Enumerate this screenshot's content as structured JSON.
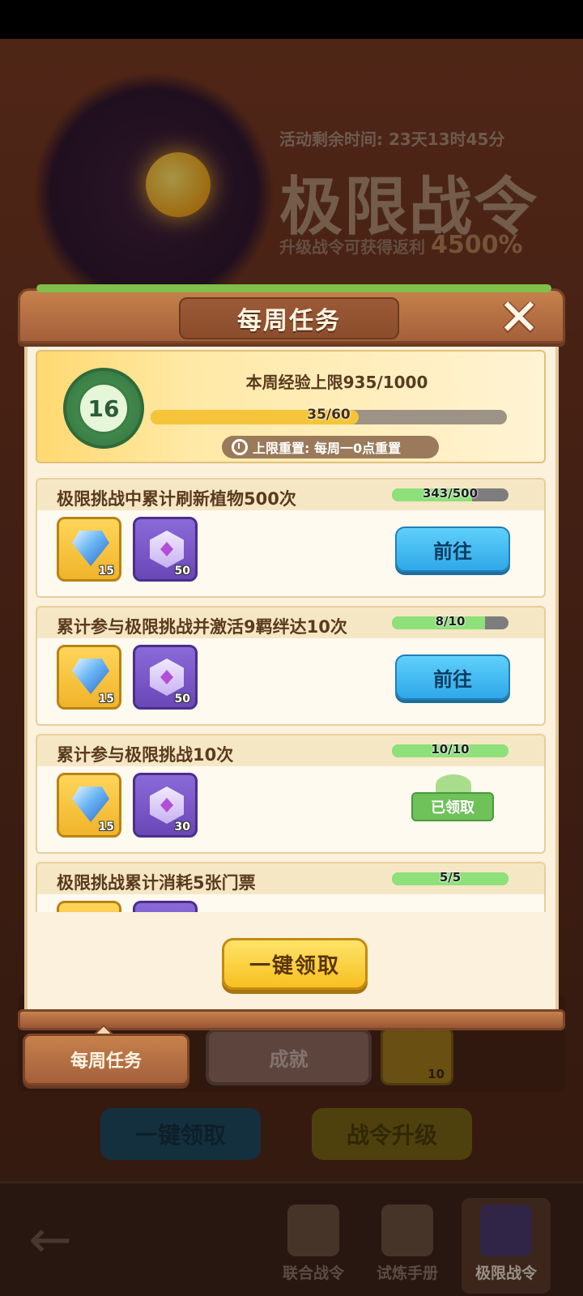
{
  "background": {
    "activity_timer": "活动剩余时间: 23天13时45分",
    "title": "极限战令",
    "subtitle": "升级战令可获得返利",
    "subtitle_rate": "4500%",
    "achievement_tab": "成就",
    "reward_count": "10",
    "claim_all": "一键领取",
    "upgrade": "战令升级"
  },
  "bottom_nav": {
    "items": [
      {
        "label": "联合战令"
      },
      {
        "label": "试炼手册"
      },
      {
        "label": "极限战令"
      }
    ]
  },
  "modal": {
    "title": "每周任务",
    "summary": {
      "level": "16",
      "exp_cap": "本周经验上限935/1000",
      "exp_progress_text": "35/60",
      "exp_progress": 0.583,
      "reset_text": "上限重置: 每周一0点重置"
    },
    "tasks": [
      {
        "title": "极限挑战中累计刷新植物500次",
        "progress_text": "343/500",
        "progress": 0.686,
        "rewards": [
          {
            "icon": "gem-icon",
            "count": "15"
          },
          {
            "icon": "badge-icon",
            "count": "50"
          }
        ],
        "action": "前往"
      },
      {
        "title": "累计参与极限挑战并激活9羁绊达10次",
        "progress_text": "8/10",
        "progress": 0.8,
        "rewards": [
          {
            "icon": "gem-icon",
            "count": "15"
          },
          {
            "icon": "badge-icon",
            "count": "50"
          }
        ],
        "action": "前往"
      },
      {
        "title": "累计参与极限挑战10次",
        "progress_text": "10/10",
        "progress": 1.0,
        "rewards": [
          {
            "icon": "gem-icon",
            "count": "15"
          },
          {
            "icon": "badge-icon",
            "count": "30"
          }
        ],
        "action": "已领取"
      },
      {
        "title": "极限挑战累计消耗5张门票",
        "progress_text": "5/5",
        "progress": 1.0,
        "rewards": [],
        "action": ""
      }
    ],
    "claim_all": "一键领取",
    "weekly_tab": "每周任务"
  }
}
